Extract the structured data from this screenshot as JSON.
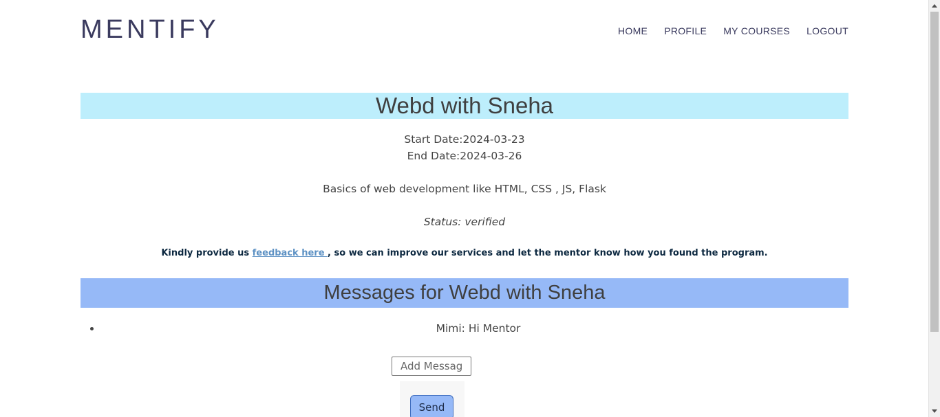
{
  "brand": "MENTIFY",
  "nav": {
    "home": "HOME",
    "profile": "PROFILE",
    "my_courses": "MY COURSES",
    "logout": "LOGOUT"
  },
  "course": {
    "title": "Webd with Sneha",
    "start_date": "Start Date:2024-03-23",
    "end_date": "End Date:2024-03-26",
    "description": "Basics of web development like HTML, CSS , JS, Flask",
    "status": "Status: verified"
  },
  "feedback": {
    "prefix": "Kindly provide us ",
    "link_text": "feedback here ",
    "suffix": ", so we can improve our services and let the mentor know how you found the program."
  },
  "messages": {
    "title": "Messages for Webd with Sneha",
    "items": [
      "Mimi: Hi Mentor"
    ],
    "input_placeholder": "Add Message",
    "send_label": "Send"
  },
  "colors": {
    "course_banner": "#bdeefc",
    "messages_banner": "#96b9f7",
    "link": "#5e92c4"
  }
}
